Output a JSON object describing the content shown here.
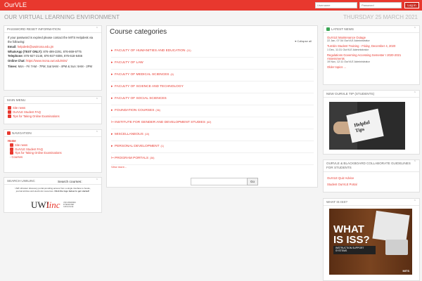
{
  "header": {
    "brand": "OurVLE",
    "username_placeholder": "Username",
    "password_placeholder": "Password",
    "login_label": "Log in",
    "site_title": "OUR VIRTUAL LEARNING ENVIRONMENT",
    "date": "THURSDAY 25 MARCH 2021"
  },
  "password_block": {
    "title": "PASSWORD RESET INFORMATION",
    "intro": "If your password is expired please contact the MITS Helpdesk via the following:",
    "email_label": "Email:",
    "email": "helpdesk@uwimona.edu.jm",
    "whatsapp_label": "WhatsApp (TEXT ONLY):",
    "whatsapp": "876-499-2291, 876-869-9775",
    "telephone_label": "Telephone:",
    "telephone": "876-927-2148, 876-927-9306, 876-618-6466",
    "chat_label": "Online Chat:",
    "chat": "https://www.mona.uwi.edu/mits/",
    "times_label": "Times:",
    "times": "Mon - Fri 7AM - 7PM; Sat 9AM - 4PM & Sun: 9AM - 2PM"
  },
  "main_menu": {
    "title": "MAIN MENU",
    "items": [
      "Site news",
      "OurVLE Student FAQ",
      "Tips for Taking Online Examinations"
    ]
  },
  "navigation": {
    "title": "NAVIGATION",
    "home": "Home",
    "items": [
      "Site news",
      "OurVLE Student FAQ",
      "Tips for Taking Online Examinations",
      "Courses"
    ]
  },
  "search_uwilinc": {
    "title": "SEARCH UWILINC",
    "text1": "UWI Libraries' discovery portal providing access from a single interface to books,",
    "text2": "journal articles and electronic resources.",
    "link": "Click the logo below to get started!",
    "logo_main": "UWI",
    "logo_accent": "linc",
    "logo_sub1": "UWI LIBRARIES",
    "logo_sub2": "INTEGRATED",
    "logo_sub3": "CATALOGUE"
  },
  "course_categories": {
    "title": "Course categories",
    "collapse_label": "Collapse all",
    "view_more": "View more...",
    "search_label": "Search courses:",
    "go_label": "Go",
    "items": [
      {
        "name": "FACULTY OF HUMANITIES AND EDUCATION",
        "count": "(11)"
      },
      {
        "name": "FACULTY OF LAW",
        "count": ""
      },
      {
        "name": "FACULTY OF MEDICAL SCIENCES",
        "count": "(4)"
      },
      {
        "name": "FACULTY OF SCIENCE AND TECHNOLOGY",
        "count": ""
      },
      {
        "name": "FACULTY OF SOCIAL SCIENCES",
        "count": ""
      },
      {
        "name": "FOUNDATION COURSES",
        "count": "(36)"
      },
      {
        "name": "INSTITUTE FOR GENDER AND DEVELOPMENT STUDIES",
        "count": "(62)"
      },
      {
        "name": "MISCELLANEOUS",
        "count": "(10)"
      },
      {
        "name": "PERSONAL DEVELOPMENT",
        "count": "(1)"
      },
      {
        "name": "PROGRAM PORTALS",
        "count": "(36)"
      }
    ]
  },
  "latest_news": {
    "title": "LATEST NEWS",
    "items": [
      {
        "title": "OurVLE Maintenance Outage",
        "date": "22 Jan, 07:34",
        "author": "OurVLE Administrator"
      },
      {
        "title": "Turnitin Student Training - Friday, December 4, 2020",
        "date": "1 Dec, 11:31",
        "author": "OurVLE Administrator"
      },
      {
        "title": "Regulations Governing Accessing Semester I 2020-2021 Assessments",
        "date": "19 Nov, 12:11",
        "author": "OurVLE Administrator"
      }
    ],
    "older": "Older topics ..."
  },
  "tip_block": {
    "title": "NEW OURVLE TIP (STUDENTS)",
    "card_text": "Helpful Tips"
  },
  "collab_block": {
    "title": "OURVLE & BLACKBOARD COLLABORATE GUIDELINES FOR STUDENTS",
    "items": [
      "OurVLE Quiz Advice",
      "Student OurVLE Portal"
    ]
  },
  "iss_block": {
    "title": "WHAT IS ISS?",
    "headline": "WHAT IS ISS?",
    "subtitle1": "INSTRUCTION SUPPORT",
    "subtitle2": "SYSTEMS",
    "brand": "MITS"
  }
}
